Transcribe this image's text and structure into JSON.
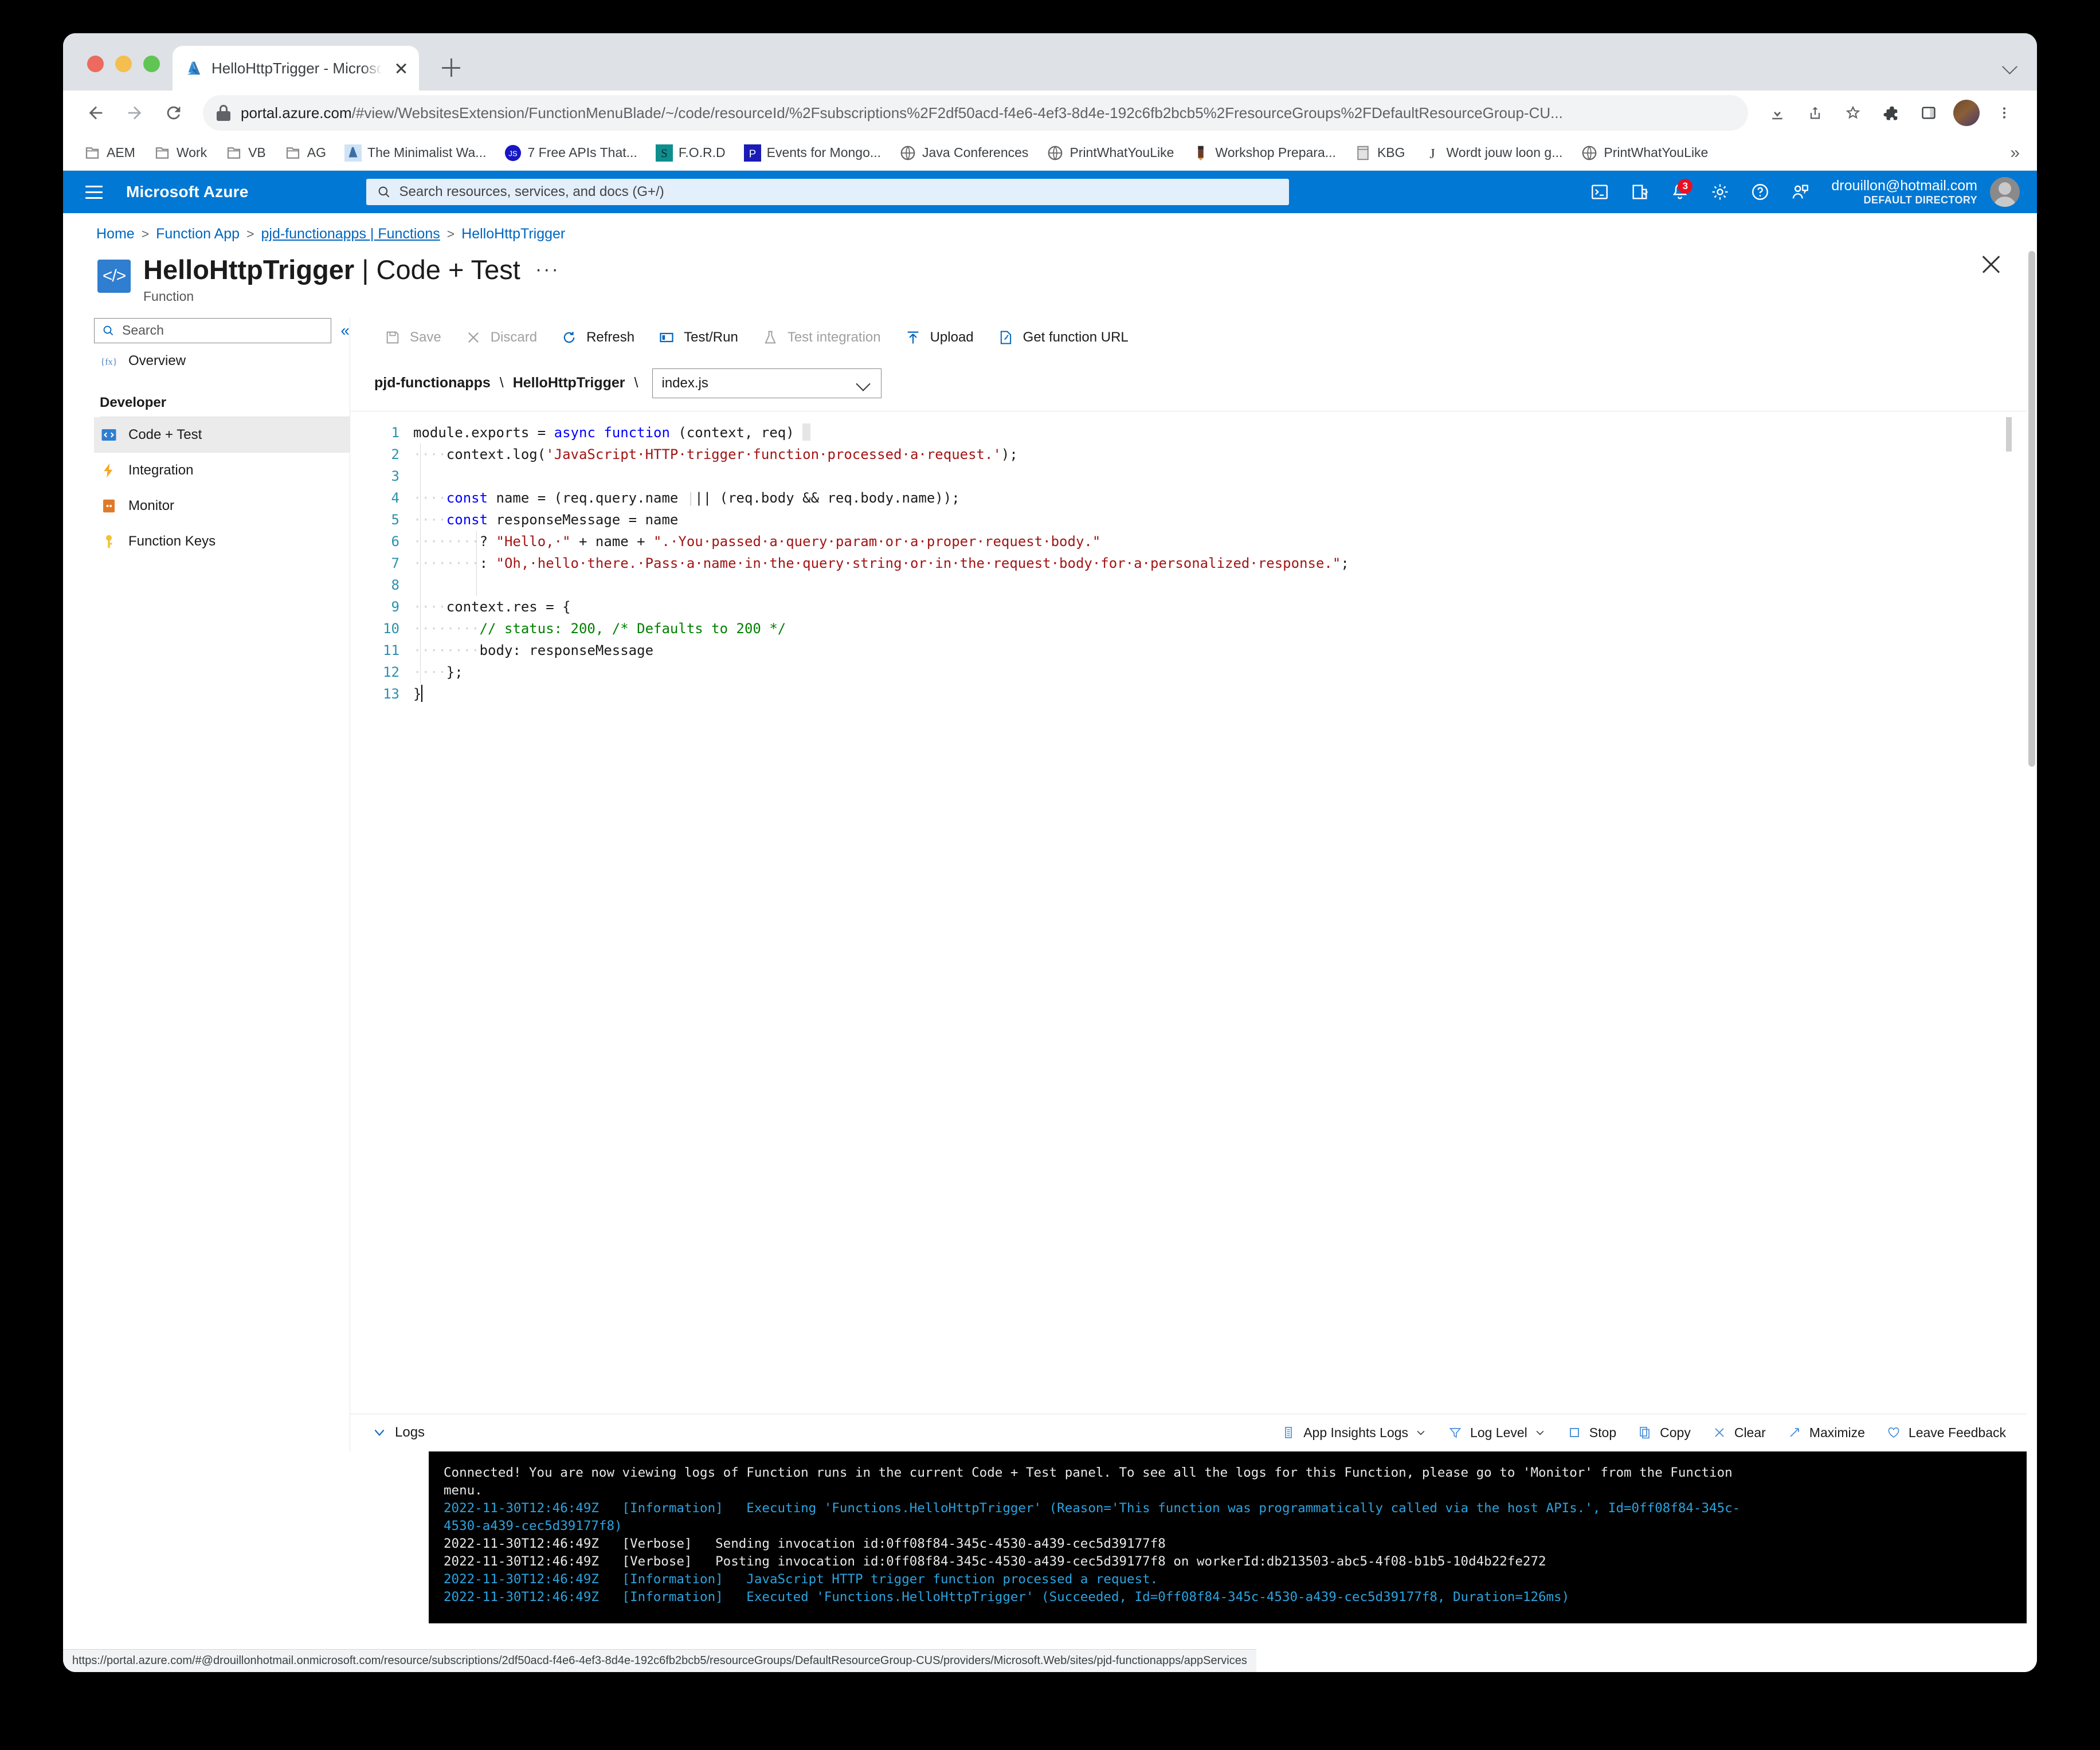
{
  "browser": {
    "tab": {
      "title": "HelloHttpTrigger - Microsoft Az",
      "favicon": "azure-icon"
    },
    "newtab_label": "+",
    "url_prefix": "portal.azure.com",
    "url_rest": "/#view/WebsitesExtension/FunctionMenuBlade/~/code/resourceId/%2Fsubscriptions%2F2df50acd-f4e6-4ef3-8d4e-192c6fb2bcb5%2FresourceGroups%2FDefaultResourceGroup-CU...",
    "bookmarks": [
      {
        "label": "AEM",
        "icon": "folder-icon"
      },
      {
        "label": "Work",
        "icon": "folder-icon"
      },
      {
        "label": "VB",
        "icon": "folder-icon"
      },
      {
        "label": "AG",
        "icon": "folder-icon"
      },
      {
        "label": "The Minimalist Wa...",
        "icon": "azure-icon"
      },
      {
        "label": "7 Free APIs That...",
        "icon": "js-icon"
      },
      {
        "label": "F.O.R.D",
        "icon": "s-icon"
      },
      {
        "label": "Events for Mongo...",
        "icon": "p-icon"
      },
      {
        "label": "Java Conferences",
        "icon": "globe-icon"
      },
      {
        "label": "PrintWhatYouLike",
        "icon": "globe-icon"
      },
      {
        "label": "Workshop Prepara...",
        "icon": "pen-icon"
      },
      {
        "label": "KBG",
        "icon": "doc-icon"
      },
      {
        "label": "Wordt jouw loon g...",
        "icon": "j-icon"
      },
      {
        "label": "PrintWhatYouLike",
        "icon": "globe-icon"
      }
    ],
    "bookmarks_overflow": "»",
    "status_url": "https://portal.azure.com/#@drouillonhotmail.onmicrosoft.com/resource/subscriptions/2df50acd-f4e6-4ef3-8d4e-192c6fb2bcb5/resourceGroups/DefaultResourceGroup-CUS/providers/Microsoft.Web/sites/pjd-functionapps/appServices"
  },
  "azure_header": {
    "brand": "Microsoft Azure",
    "search_placeholder": "Search resources, services, and docs (G+/)",
    "notification_count": "3",
    "account_email": "drouillon@hotmail.com",
    "account_directory": "DEFAULT DIRECTORY",
    "icons": [
      "cloud-shell-icon",
      "directories-subscriptions-icon",
      "notifications-icon",
      "settings-icon",
      "help-icon",
      "feedback-icon"
    ]
  },
  "breadcrumb": [
    {
      "label": "Home",
      "underlined": false
    },
    {
      "label": "Function App",
      "underlined": false
    },
    {
      "label": "pjd-functionapps | Functions",
      "underlined": true
    },
    {
      "label": "HelloHttpTrigger",
      "underlined": false
    }
  ],
  "blade": {
    "title_main": "HelloHttpTrigger",
    "title_sep": "|",
    "title_sub": "Code + Test",
    "subtitle": "Function",
    "ellipsis": "···",
    "icon": "code-blade-icon"
  },
  "sidebar": {
    "search_placeholder": "Search",
    "collapse_label": "«",
    "items": [
      {
        "label": "Overview",
        "icon": "function-fx-icon",
        "selected": false
      },
      {
        "label": "Code + Test",
        "icon": "code-icon",
        "selected": true
      },
      {
        "label": "Integration",
        "icon": "lightning-icon",
        "selected": false
      },
      {
        "label": "Monitor",
        "icon": "monitor-icon",
        "selected": false
      },
      {
        "label": "Function Keys",
        "icon": "key-icon",
        "selected": false
      }
    ],
    "group_label": "Developer"
  },
  "command_bar": [
    {
      "label": "Save",
      "icon": "save-icon",
      "disabled": true
    },
    {
      "label": "Discard",
      "icon": "discard-x-icon",
      "disabled": true
    },
    {
      "label": "Refresh",
      "icon": "refresh-icon",
      "disabled": false
    },
    {
      "label": "Test/Run",
      "icon": "test-run-icon",
      "disabled": false
    },
    {
      "label": "Test integration",
      "icon": "flask-icon",
      "disabled": true
    },
    {
      "label": "Upload",
      "icon": "upload-arrow-icon",
      "disabled": false
    },
    {
      "label": "Get function URL",
      "icon": "link-doc-icon",
      "disabled": false
    }
  ],
  "file_bar": {
    "app": "pjd-functionapps",
    "sep": "\\",
    "function": "HelloHttpTrigger",
    "selected_file": "index.js"
  },
  "editor": {
    "lines": [
      {
        "n": "1",
        "html": "module.exports = <k>async function</k> (context, req) <box></box>"
      },
      {
        "n": "2",
        "html": "<w>····</w>context.log(<s>'JavaScript·HTTP·trigger·function·processed·a·request.'</s>);"
      },
      {
        "n": "3",
        "html": ""
      },
      {
        "n": "4",
        "html": "<w>····</w><k>const</k> name = (req.query.name <w>|</w>|| (req.body && req.body.name));"
      },
      {
        "n": "5",
        "html": "<w>····</w><k>const</k> responseMessage = name"
      },
      {
        "n": "6",
        "html": "<w>········</w>? <s>\"Hello,·\"</s> + name + <s>\".·You·passed·a·query·param·or·a·proper·request·body.\"</s>"
      },
      {
        "n": "7",
        "html": "<w>········</w>: <s>\"Oh,·hello·there.·Pass·a·name·in·the·query·string·or·in·the·request·body·for·a·personalized·response.\"</s>;"
      },
      {
        "n": "8",
        "html": ""
      },
      {
        "n": "9",
        "html": "<w>····</w>context.res = {"
      },
      {
        "n": "10",
        "html": "<w>········</w><c>// status: 200, /* Defaults to 200 */</c>"
      },
      {
        "n": "11",
        "html": "<w>········</w>body: responseMessage"
      },
      {
        "n": "12",
        "html": "<w>····</w>};"
      },
      {
        "n": "13",
        "html": "}<caret></caret>"
      }
    ],
    "plain_text": "module.exports = async function (context, req) {\n    context.log('JavaScript HTTP trigger function processed a request.');\n\n    const name = (req.query.name || (req.body && req.body.name));\n    const responseMessage = name\n        ? \"Hello, \" + name + \". You passed a query param or a proper request body.\"\n        : \"Oh, hello there. Pass a name in the query string or in the request body for a personalized response.\";\n\n    context.res = {\n        // status: 200, /* Defaults to 200 */\n        body: responseMessage\n    };\n}"
  },
  "logs_panel": {
    "toggle_label": "Logs",
    "actions": [
      {
        "label": "App Insights Logs",
        "icon": "list-icon",
        "caret": true
      },
      {
        "label": "Log Level",
        "icon": "filter-icon",
        "caret": true
      },
      {
        "label": "Stop",
        "icon": "stop-square-icon",
        "caret": false
      },
      {
        "label": "Copy",
        "icon": "copy-icon",
        "caret": false
      },
      {
        "label": "Clear",
        "icon": "clear-x-icon",
        "caret": false
      },
      {
        "label": "Maximize",
        "icon": "maximize-icon",
        "caret": false
      },
      {
        "label": "Leave Feedback",
        "icon": "heart-icon",
        "caret": false
      }
    ],
    "console_lines": [
      {
        "text": "Connected! You are now viewing logs of Function runs in the current Code + Test panel. To see all the logs for this Function, please go to 'Monitor' from the Function",
        "style": "white"
      },
      {
        "text": "menu.",
        "style": "white"
      },
      {
        "text": "",
        "style": "white"
      },
      {
        "text": "2022-11-30T12:46:49Z   [Information]   Executing 'Functions.HelloHttpTrigger' (Reason='This function was programmatically called via the host APIs.', Id=0ff08f84-345c-",
        "style": "info"
      },
      {
        "text": "4530-a439-cec5d39177f8)",
        "style": "info"
      },
      {
        "text": "2022-11-30T12:46:49Z   [Verbose]   Sending invocation id:0ff08f84-345c-4530-a439-cec5d39177f8",
        "style": "white"
      },
      {
        "text": "2022-11-30T12:46:49Z   [Verbose]   Posting invocation id:0ff08f84-345c-4530-a439-cec5d39177f8 on workerId:db213503-abc5-4f08-b1b5-10d4b22fe272",
        "style": "white"
      },
      {
        "text": "2022-11-30T12:46:49Z   [Information]   JavaScript HTTP trigger function processed a request.",
        "style": "info"
      },
      {
        "text": "2022-11-30T12:46:49Z   [Information]   Executed 'Functions.HelloHttpTrigger' (Succeeded, Id=0ff08f84-345c-4530-a439-cec5d39177f8, Duration=126ms)",
        "style": "info"
      }
    ]
  },
  "colors": {
    "azure_blue": "#0078d4",
    "link_blue": "#0066c0",
    "selected_grey": "#ebebeb",
    "console_bg": "#000000",
    "console_info": "#2ba4e0",
    "code_keyword": "#0000ff",
    "code_string": "#a31515",
    "code_comment": "#008000",
    "line_number": "#2b91af"
  }
}
